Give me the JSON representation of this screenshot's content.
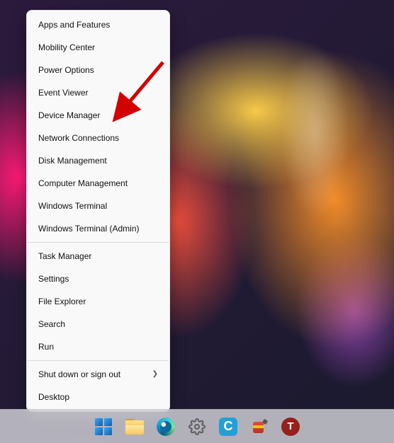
{
  "context_menu": {
    "groups": [
      [
        {
          "label": "Apps and Features",
          "key": "apps-and-features"
        },
        {
          "label": "Mobility Center",
          "key": "mobility-center"
        },
        {
          "label": "Power Options",
          "key": "power-options"
        },
        {
          "label": "Event Viewer",
          "key": "event-viewer"
        },
        {
          "label": "Device Manager",
          "key": "device-manager"
        },
        {
          "label": "Network Connections",
          "key": "network-connections"
        },
        {
          "label": "Disk Management",
          "key": "disk-management"
        },
        {
          "label": "Computer Management",
          "key": "computer-management"
        },
        {
          "label": "Windows Terminal",
          "key": "windows-terminal"
        },
        {
          "label": "Windows Terminal (Admin)",
          "key": "windows-terminal-admin"
        }
      ],
      [
        {
          "label": "Task Manager",
          "key": "task-manager"
        },
        {
          "label": "Settings",
          "key": "settings"
        },
        {
          "label": "File Explorer",
          "key": "file-explorer"
        },
        {
          "label": "Search",
          "key": "search"
        },
        {
          "label": "Run",
          "key": "run"
        }
      ],
      [
        {
          "label": "Shut down or sign out",
          "key": "shutdown-signout",
          "submenu": true
        },
        {
          "label": "Desktop",
          "key": "desktop"
        }
      ]
    ]
  },
  "taskbar": {
    "items": [
      {
        "name": "start-button",
        "icon": "windows-start-icon"
      },
      {
        "name": "file-explorer-taskbar",
        "icon": "folder-icon"
      },
      {
        "name": "edge-taskbar",
        "icon": "edge-icon"
      },
      {
        "name": "settings-taskbar",
        "icon": "gear-icon"
      },
      {
        "name": "app-c-taskbar",
        "icon": "c-icon",
        "letter": "C"
      },
      {
        "name": "app-fuel-taskbar",
        "icon": "fuelcan-icon"
      },
      {
        "name": "app-t-taskbar",
        "icon": "t-icon",
        "letter": "T"
      }
    ]
  },
  "annotation": {
    "arrow_target": "device-manager"
  }
}
